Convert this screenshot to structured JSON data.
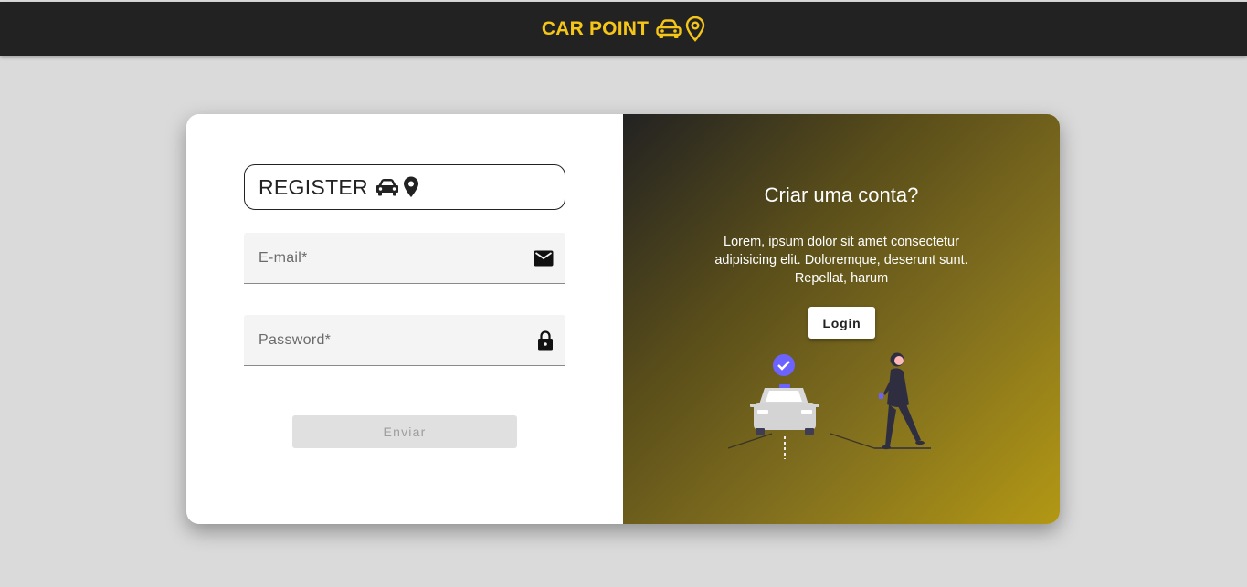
{
  "header": {
    "brand_title": "CAR POINT",
    "brand_icons": [
      "car-icon",
      "map-pin-outline-icon"
    ],
    "accent_color": "#f5c518",
    "bar_color": "#222222"
  },
  "register_form": {
    "title": "REGISTER",
    "title_icons": [
      "car-icon",
      "map-pin-icon"
    ],
    "email": {
      "placeholder": "E-mail*",
      "value": "",
      "icon": "mail-icon"
    },
    "password": {
      "placeholder": "Password*",
      "value": "",
      "icon": "lock-icon"
    },
    "submit_label": "Enviar"
  },
  "side_panel": {
    "heading": "Criar uma conta?",
    "text": "Lorem, ipsum dolor sit amet consectetur adipisicing elit. Doloremque, deserunt sunt. Repellat, harum",
    "login_label": "Login",
    "illustration": "car-and-person-illustration"
  }
}
